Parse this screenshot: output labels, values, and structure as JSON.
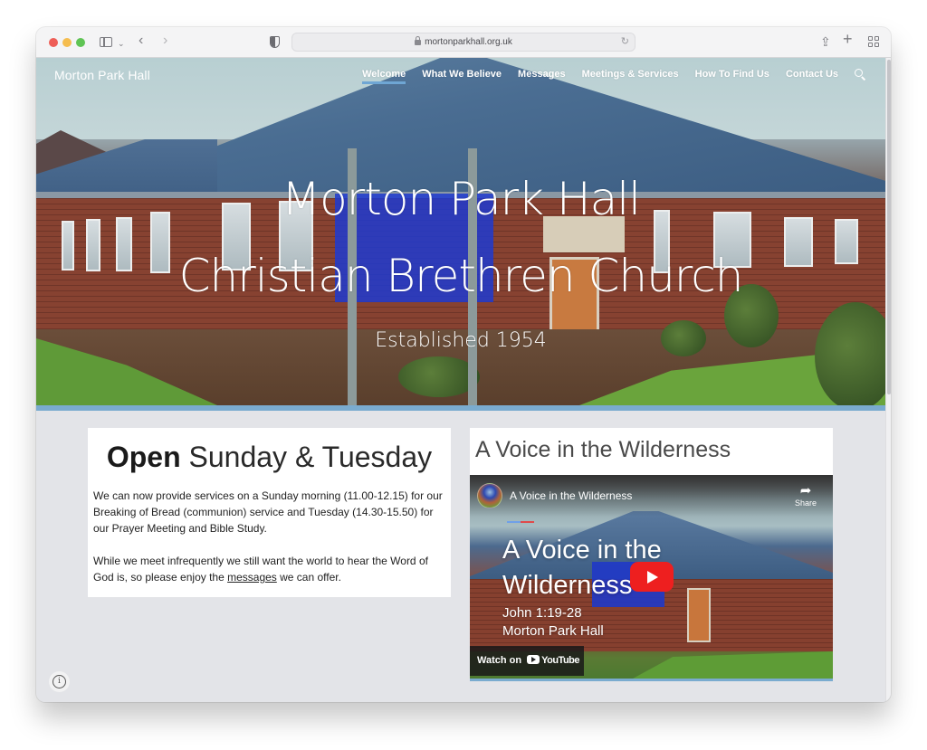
{
  "browser": {
    "url": "mortonparkhall.org.uk",
    "icons": [
      "sidebar-icon",
      "chevron-down-icon",
      "back-icon",
      "forward-icon",
      "privacy-shield-icon",
      "lock-icon",
      "reload-icon",
      "share-icon",
      "new-tab-icon",
      "tab-overview-icon"
    ]
  },
  "site": {
    "title": "Morton Park Hall",
    "nav": [
      {
        "label": "Welcome",
        "active": true
      },
      {
        "label": "What We Believe",
        "active": false
      },
      {
        "label": "Messages",
        "active": false
      },
      {
        "label": "Meetings & Services",
        "active": false
      },
      {
        "label": "How To Find Us",
        "active": false
      },
      {
        "label": "Contact Us",
        "active": false
      }
    ],
    "accent_color": "#7aabcf"
  },
  "hero": {
    "line1": "Morton Park Hall",
    "line2": "Christian Brethren Church",
    "subtitle": "Established 1954"
  },
  "open_card": {
    "title_bold": "Open",
    "title_rest": " Sunday & Tuesday",
    "para1": "We can now provide services on a Sunday morning (11.00-12.15) for our Breaking of Bread (communion) service and Tuesday (14.30-15.50) for our Prayer Meeting and Bible Study.",
    "para2_before": "While we meet infrequently we still want the world to hear the Word of God is, so please enjoy the ",
    "para2_link": "messages",
    "para2_after": " we can offer."
  },
  "video_card": {
    "title": "A Voice in the Wilderness",
    "video": {
      "channel_title": "A Voice in the Wilderness",
      "share_label": "Share",
      "overlay_title_line1": "A Voice in the",
      "overlay_title_line2": "Wilderness",
      "overlay_sub_line1": "John 1:19-28",
      "overlay_sub_line2": "Morton Park Hall",
      "watch_on_label": "Watch on",
      "youtube_label": "YouTube"
    }
  },
  "info_icon": "i"
}
